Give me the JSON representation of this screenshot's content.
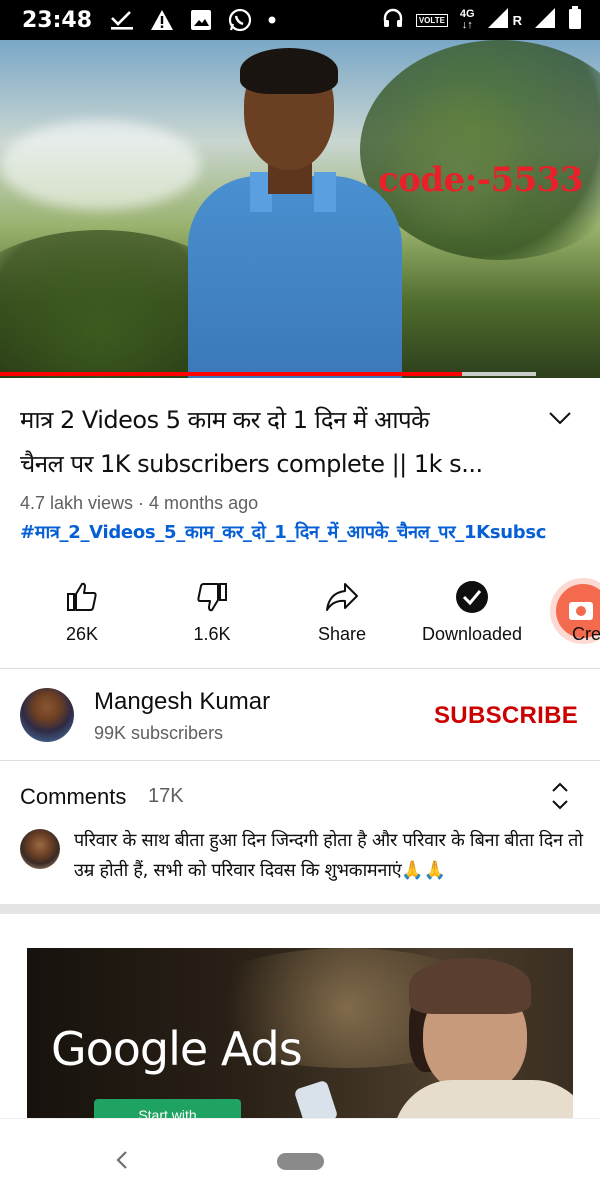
{
  "status_bar": {
    "time": "23:48",
    "volte": "VOLTE",
    "network": "4G",
    "roaming": "R"
  },
  "video": {
    "overlay_code": "code:-5533",
    "progress": 0.77
  },
  "details": {
    "title_line1": "मात्र 2 Videos 5 काम कर दो 1 दिन में आपके",
    "title_line2": "चैनल पर 1K subscribers complete || 1k s...",
    "meta": "4.7 lakh views · 4 months ago",
    "hashtag": "#मात्र_2_Videos_5_काम_कर_दो_1_दिन_में_आपके_चैनल_पर_1Ksubsc"
  },
  "actions": {
    "like": "26K",
    "dislike": "1.6K",
    "share": "Share",
    "downloaded": "Downloaded",
    "create": "Cre"
  },
  "channel": {
    "name": "Mangesh Kumar",
    "subscribers": "99K subscribers",
    "subscribe_label": "SUBSCRIBE"
  },
  "comments": {
    "header": "Comments",
    "count": "17K",
    "top_comment": "परिवार के साथ बीता हुआ दिन जिन्दगी होता है और परिवार के बिना बीता दिन तो उम्र होती हैं, सभी को परिवार दिवस कि शुभकामनाएं🙏🙏"
  },
  "ad": {
    "logo_text": "Google Ads",
    "cta": "Start with"
  },
  "colors": {
    "brand_red": "#ff0000",
    "subscribe_red": "#cc0000",
    "link_blue": "#065fd4",
    "code_red": "#e8202a"
  }
}
